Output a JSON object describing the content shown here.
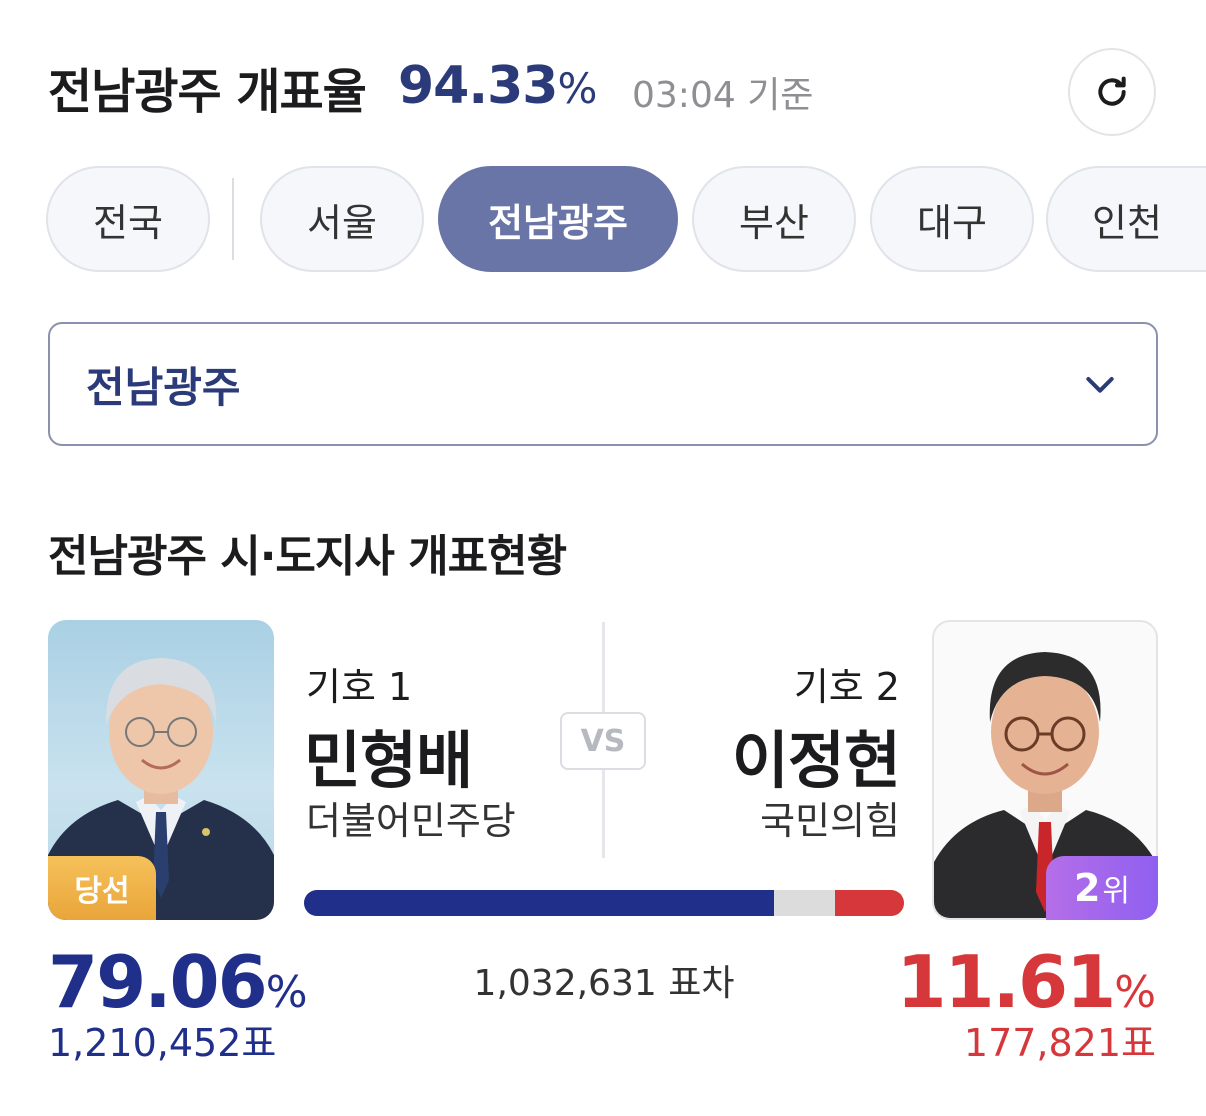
{
  "header": {
    "title": "전남광주 개표율",
    "count_rate": "94.33",
    "count_rate_unit": "%",
    "time": "03:04 기준"
  },
  "tabs": [
    {
      "label": "전국",
      "active": false
    },
    {
      "label": "서울",
      "active": false
    },
    {
      "label": "전남광주",
      "active": true
    },
    {
      "label": "부산",
      "active": false
    },
    {
      "label": "대구",
      "active": false
    },
    {
      "label": "인천",
      "active": false
    }
  ],
  "region_select": {
    "value": "전남광주"
  },
  "section": {
    "title": "전남광주 시·도지사 개표현황"
  },
  "candidates": {
    "left": {
      "number_label": "기호 1",
      "name": "민형배",
      "party": "더불어민주당",
      "badge": "당선",
      "percent": "79.06",
      "percent_unit": "%",
      "votes": "1,210,452표",
      "color": "#1f2f8a"
    },
    "right": {
      "number_label": "기호 2",
      "name": "이정현",
      "party": "국민의힘",
      "rank_num": "2",
      "rank_suffix": "위",
      "percent": "11.61",
      "percent_unit": "%",
      "votes": "177,821표",
      "color": "#d6373a"
    }
  },
  "vs_label": "VS",
  "vote_bar": {
    "left_share": 79.06,
    "other_share": 9.33,
    "right_share": 11.61
  },
  "vote_gap": "1,032,631 표차"
}
